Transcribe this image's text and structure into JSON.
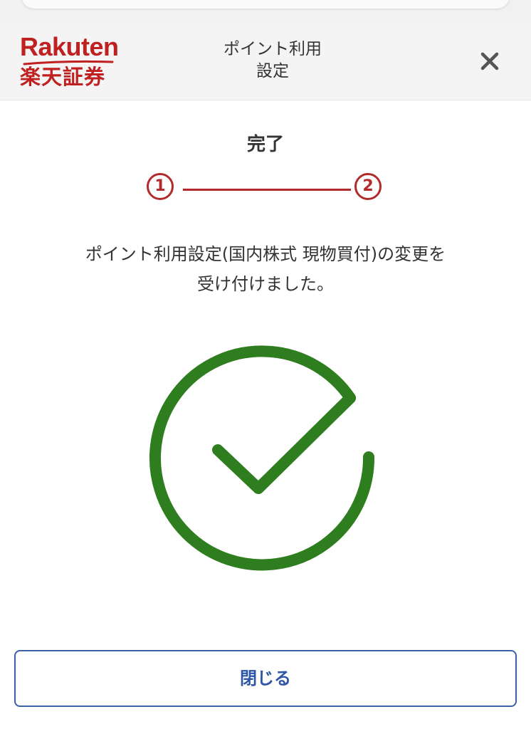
{
  "header": {
    "brand_en": "Rakuten",
    "brand_ja": "楽天証券",
    "title_line1": "ポイント利用",
    "title_line2": "設定",
    "close_icon": "close-icon"
  },
  "step": {
    "title": "完了",
    "steps": [
      "1",
      "2"
    ],
    "current": 2
  },
  "message": {
    "line1": "ポイント利用設定(国内株式 現物買付)の変更を",
    "line2": "受け付けました。"
  },
  "status_icon": "check-circle-icon",
  "footer": {
    "close_label": "閉じる"
  },
  "colors": {
    "brand": "#bf2020",
    "stepper": "#b32a2a",
    "success": "#2e7d1f",
    "button": "#2e56a4"
  }
}
